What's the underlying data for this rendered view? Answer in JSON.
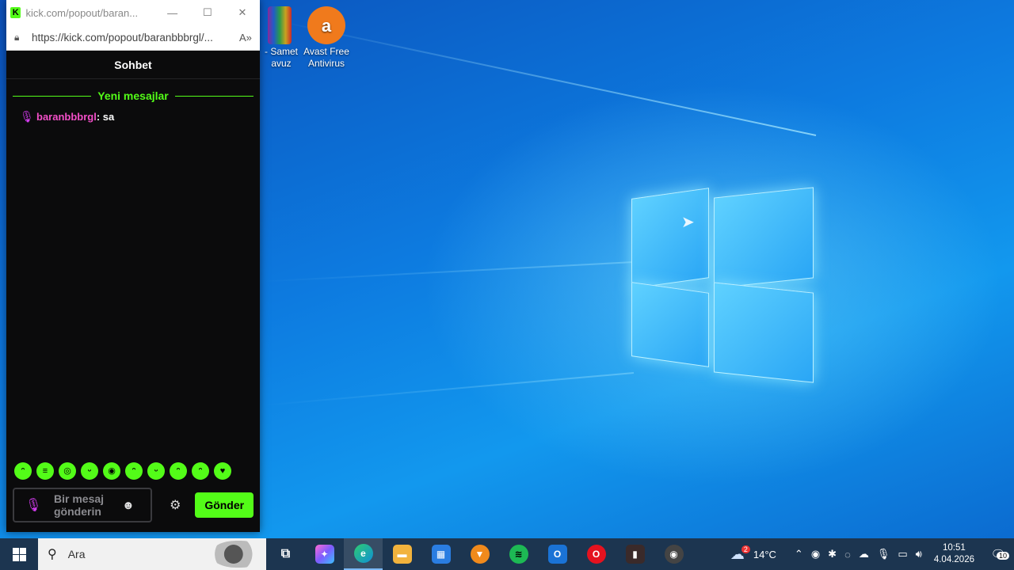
{
  "desktop": {
    "icons": [
      {
        "label_line1": "- Samet",
        "label_line2": "avuz"
      },
      {
        "label_line1": "Avast Free",
        "label_line2": "Antivirus"
      }
    ]
  },
  "popup": {
    "title": "kick.com/popout/baran...",
    "url": "https://kick.com/popout/baranbbbrgl/...",
    "logo_letter": "K",
    "chat_title": "Sohbet",
    "new_messages_label": "Yeni mesajlar",
    "messages": [
      {
        "username": "baranbbbrgl",
        "separator": ": ",
        "text": "sa"
      }
    ],
    "emotes": [
      "ᵔ",
      "≡",
      "◎",
      "ᵕ",
      "◉",
      "ᵔ",
      "ᵕ",
      "ᵔ",
      "ᵔ",
      "♥"
    ],
    "input_placeholder": "Bir mesaj gönderin",
    "send_label": "Gönder",
    "accent": "#53fc18"
  },
  "taskbar": {
    "search_placeholder": "Ara",
    "apps": [
      {
        "name": "task-view",
        "glyph": "⧉",
        "color": "#1c3550"
      },
      {
        "name": "copilot",
        "glyph": "✦",
        "color": "#7c5cff"
      },
      {
        "name": "edge",
        "glyph": "e",
        "color": "#0fa3c9"
      },
      {
        "name": "file-explorer",
        "glyph": "▬",
        "color": "#f2b33d"
      },
      {
        "name": "microsoft-store",
        "glyph": "▦",
        "color": "#2a7de1"
      },
      {
        "name": "brave",
        "glyph": "▼",
        "color": "#f08a1c"
      },
      {
        "name": "spotify",
        "glyph": "≋",
        "color": "#1db954"
      },
      {
        "name": "outlook",
        "glyph": "O",
        "color": "#1a73d6"
      },
      {
        "name": "opera",
        "glyph": "O",
        "color": "#e5121f"
      },
      {
        "name": "media-app",
        "glyph": "▮",
        "color": "#3a2a2a"
      },
      {
        "name": "recorder",
        "glyph": "◉",
        "color": "#444"
      }
    ],
    "weather": {
      "temp": "14°C",
      "badge": "2"
    },
    "clock": {
      "time": "10:51",
      "date": "4.04.2026"
    },
    "notifications_count": "10"
  }
}
